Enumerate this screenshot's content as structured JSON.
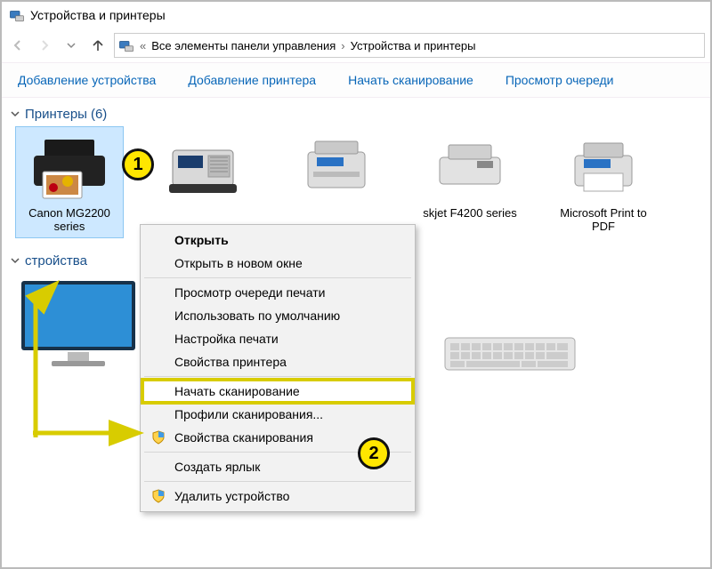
{
  "window": {
    "title": "Устройства и принтеры"
  },
  "breadcrumb": {
    "prefix_symbol": "«",
    "part1": "Все элементы панели управления",
    "part2": "Устройства и принтеры"
  },
  "toolbar": {
    "add_device": "Добавление устройства",
    "add_printer": "Добавление принтера",
    "start_scan": "Начать сканирование",
    "view_queue": "Просмотр очереди"
  },
  "groups": {
    "printers": {
      "label": "Принтеры",
      "count_suffix": "(6)"
    },
    "devices_partial": {
      "label": "стройства"
    }
  },
  "printers": [
    {
      "label": "Canon MG2200 series"
    },
    {
      "label": ""
    },
    {
      "label": ""
    },
    {
      "label": "skjet F4200 series"
    },
    {
      "label": "Microsoft Print to PDF"
    }
  ],
  "context_menu": {
    "open": "Открыть",
    "open_new": "Открыть в новом окне",
    "view_queue": "Просмотр очереди печати",
    "set_default": "Использовать по умолчанию",
    "printing_prefs": "Настройка печати",
    "printer_props": "Свойства принтера",
    "start_scan": "Начать сканирование",
    "scan_profiles": "Профили сканирования...",
    "scan_props": "Свойства сканирования",
    "create_shortcut": "Создать ярлык",
    "remove_device": "Удалить устройство"
  },
  "callouts": {
    "one": "1",
    "two": "2"
  }
}
